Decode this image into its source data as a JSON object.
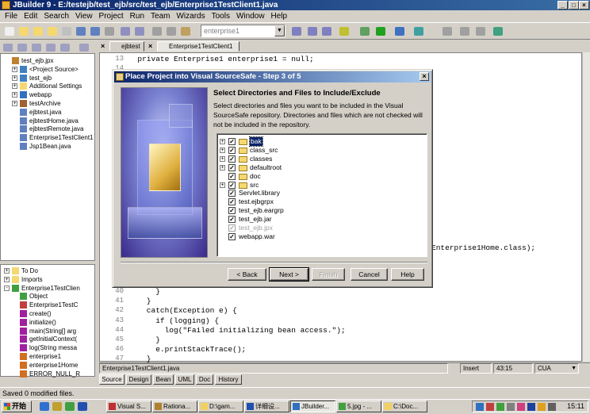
{
  "window": {
    "title": "JBuilder 9 - E:/testejb/test_ejb/src/test_ejb/Enterprise1TestClient1.java"
  },
  "menu": [
    "File",
    "Edit",
    "Search",
    "View",
    "Project",
    "Run",
    "Team",
    "Wizards",
    "Tools",
    "Window",
    "Help"
  ],
  "toolbar": {
    "search_value": "enterprise1"
  },
  "left_tabs": [
    "ejbtest",
    "Enterprise1TestClient1"
  ],
  "project_tree": [
    {
      "label": "test_ejb.jpx",
      "icon": "project-icon",
      "depth": 0,
      "exp": ""
    },
    {
      "label": "<Project Source>",
      "icon": "package-icon",
      "depth": 1,
      "exp": "+"
    },
    {
      "label": "test_ejb",
      "icon": "package-icon",
      "depth": 1,
      "exp": "+"
    },
    {
      "label": "Additional Settings",
      "icon": "folder-icon",
      "depth": 1,
      "exp": "+"
    },
    {
      "label": "webapp",
      "icon": "globe-icon",
      "depth": 1,
      "exp": "+"
    },
    {
      "label": "testArchive",
      "icon": "archive-icon",
      "depth": 1,
      "exp": "+"
    },
    {
      "label": "ejbtest.java",
      "icon": "java-file-icon",
      "depth": 1,
      "exp": ""
    },
    {
      "label": "ejbtestHome.java",
      "icon": "java-file-icon",
      "depth": 1,
      "exp": ""
    },
    {
      "label": "ejbtestRemote.java",
      "icon": "java-file-icon",
      "depth": 1,
      "exp": ""
    },
    {
      "label": "Enterprise1TestClient1.ja",
      "icon": "java-file-icon",
      "depth": 1,
      "exp": ""
    },
    {
      "label": "Jsp1Bean.java",
      "icon": "java-file-icon",
      "depth": 1,
      "exp": ""
    }
  ],
  "structure_tree": [
    {
      "label": "To Do",
      "icon": "folder-icon",
      "depth": 0,
      "exp": "+"
    },
    {
      "label": "Imports",
      "icon": "folder-icon",
      "depth": 0,
      "exp": "+"
    },
    {
      "label": "Enterprise1TestClien",
      "icon": "class-icon",
      "depth": 0,
      "exp": "-"
    },
    {
      "label": "Object",
      "icon": "class-icon",
      "depth": 1,
      "exp": ""
    },
    {
      "label": "Enterprise1TestC",
      "icon": "constructor-icon",
      "depth": 1,
      "exp": ""
    },
    {
      "label": "create()",
      "icon": "method-icon",
      "depth": 1,
      "exp": ""
    },
    {
      "label": "initialize()",
      "icon": "method-icon",
      "depth": 1,
      "exp": ""
    },
    {
      "label": "main(String[] arg",
      "icon": "method-icon",
      "depth": 1,
      "exp": ""
    },
    {
      "label": "getInitialContext(",
      "icon": "method-icon",
      "depth": 1,
      "exp": ""
    },
    {
      "label": "log(String messa",
      "icon": "method-icon",
      "depth": 1,
      "exp": ""
    },
    {
      "label": "enterprise1",
      "icon": "field-icon",
      "depth": 1,
      "exp": ""
    },
    {
      "label": "enterprise1Home",
      "icon": "field-icon",
      "depth": 1,
      "exp": ""
    },
    {
      "label": "ERROR_NULL_R",
      "icon": "field-icon",
      "depth": 1,
      "exp": ""
    }
  ],
  "editor": {
    "top_lines": [
      {
        "n": "13",
        "code": "  private Enterprise1 enterprise1 = null;"
      },
      {
        "n": "14",
        "code": ""
      }
    ],
    "mid_fragment": "Enterprise1Home.class);",
    "bottom_lines": [
      {
        "n": "40",
        "code": "      }"
      },
      {
        "n": "41",
        "code": "    }"
      },
      {
        "n": "42",
        "code": "    catch(Exception e) {"
      },
      {
        "n": "43",
        "code": "      if (logging) {"
      },
      {
        "n": "44",
        "code": "        log(\"Failed initializing bean access.\");"
      },
      {
        "n": "45",
        "code": "      }"
      },
      {
        "n": "46",
        "code": "      e.printStackTrace();"
      },
      {
        "n": "47",
        "code": "    }"
      }
    ]
  },
  "editor_status": {
    "file": "Enterprise1TestClient1.java",
    "mode": "Insert",
    "position": "43:15",
    "keymap": "CUA"
  },
  "view_tabs": [
    "Source",
    "Design",
    "Bean",
    "UML",
    "Doc",
    "History"
  ],
  "status_message": "Saved 0 modified files.",
  "dialog": {
    "title": "Place Project into Visual SourceSafe - Step 3 of 5",
    "heading": "Select Directories and Files to Include/Exclude",
    "description": "Select directories and files you want to be included in the Visual SourceSafe repository. Directories and files which are not checked will not be included in the repository.",
    "items": [
      {
        "label": "bak",
        "type": "folder",
        "expandable": true,
        "checked": true,
        "selected": true,
        "dim": false
      },
      {
        "label": "class_src",
        "type": "folder",
        "expandable": true,
        "checked": true,
        "selected": false,
        "dim": false
      },
      {
        "label": "classes",
        "type": "folder",
        "expandable": true,
        "checked": true,
        "selected": false,
        "dim": false
      },
      {
        "label": "defaultroot",
        "type": "folder",
        "expandable": true,
        "checked": true,
        "selected": false,
        "dim": false
      },
      {
        "label": "doc",
        "type": "folder",
        "expandable": false,
        "checked": true,
        "selected": false,
        "dim": false
      },
      {
        "label": "src",
        "type": "folder",
        "expandable": true,
        "checked": true,
        "selected": false,
        "dim": false
      },
      {
        "label": "Servlet.library",
        "type": "file",
        "expandable": false,
        "checked": true,
        "selected": false,
        "dim": false
      },
      {
        "label": "test.ejbgrpx",
        "type": "file",
        "expandable": false,
        "checked": true,
        "selected": false,
        "dim": false
      },
      {
        "label": "test_ejb.eargrp",
        "type": "file",
        "expandable": false,
        "checked": true,
        "selected": false,
        "dim": false
      },
      {
        "label": "test_ejb.jar",
        "type": "file",
        "expandable": false,
        "checked": true,
        "selected": false,
        "dim": false
      },
      {
        "label": "test_ejb.jpx",
        "type": "file",
        "expandable": false,
        "checked": true,
        "selected": false,
        "dim": true
      },
      {
        "label": "webapp.war",
        "type": "file",
        "expandable": false,
        "checked": true,
        "selected": false,
        "dim": false
      }
    ],
    "buttons": {
      "back": "< Back",
      "next": "Next >",
      "finish": "Finish",
      "cancel": "Cancel",
      "help": "Help"
    }
  },
  "taskbar": {
    "start": "开始",
    "tasks": [
      {
        "label": "Visual S...",
        "color": "#c03030"
      },
      {
        "label": "Rationa...",
        "color": "#b08030"
      },
      {
        "label": "D:\\gam...",
        "color": "#f0d060"
      },
      {
        "label": "详细设...",
        "color": "#2050b0"
      },
      {
        "label": "JBuilder...",
        "color": "#3070c0",
        "active": true
      },
      {
        "label": "5.jpg - ...",
        "color": "#40a040"
      },
      {
        "label": "C:\\Doc...",
        "color": "#f0d060"
      }
    ],
    "clock": "15:11"
  },
  "colors": {
    "title_active": "#0a246a",
    "face": "#d4d0c8",
    "selection": "#0a246a"
  }
}
